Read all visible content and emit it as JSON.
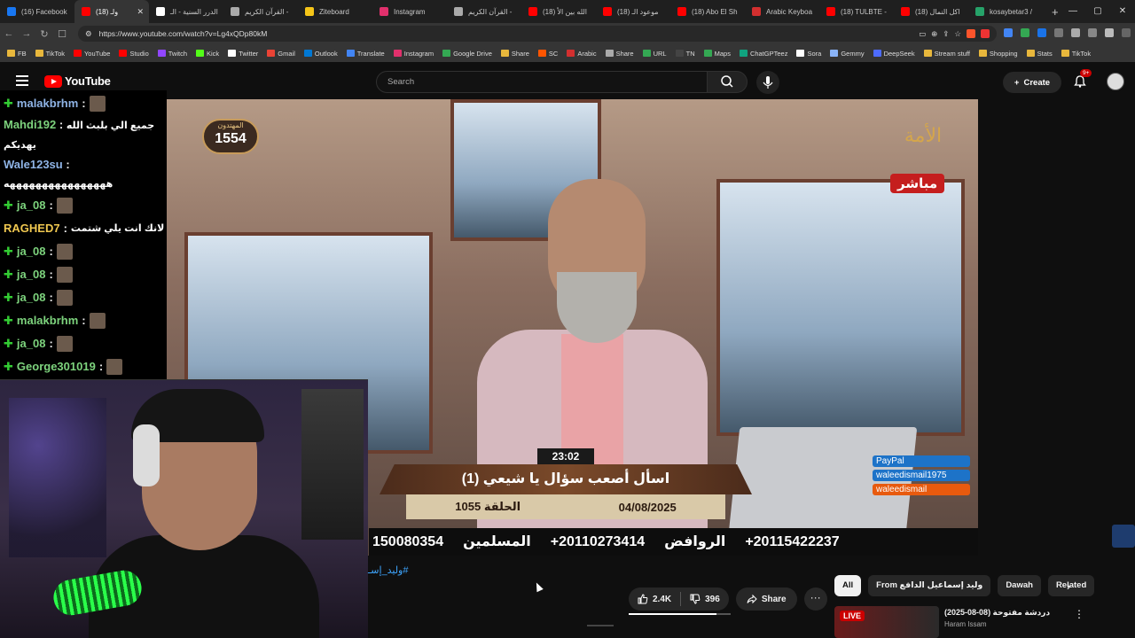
{
  "browser": {
    "tabs": [
      {
        "label": "(16) Facebook",
        "color": "#1877f2",
        "active": false
      },
      {
        "label": "(18) ولـ",
        "color": "#ff0000",
        "active": true
      },
      {
        "label": "الدرر السنية - الـ",
        "color": "#ffffff",
        "active": false
      },
      {
        "label": "القرآن الكريم - ",
        "color": "#aaaaaa",
        "active": false
      },
      {
        "label": "Ziteboard",
        "color": "#f5c518",
        "active": false
      },
      {
        "label": "Instagram",
        "color": "#e1306c",
        "active": false
      },
      {
        "label": "القرآن الكريم - ",
        "color": "#aaaaaa",
        "active": false
      },
      {
        "label": "(18) الله بين الأ",
        "color": "#ff0000",
        "active": false
      },
      {
        "label": "(18) موعود الـ",
        "color": "#ff0000",
        "active": false
      },
      {
        "label": "(18) Abo El Sh",
        "color": "#ff0000",
        "active": false
      },
      {
        "label": "Arabic Keyboa",
        "color": "#d32f2f",
        "active": false
      },
      {
        "label": "(18) TULBTE - ",
        "color": "#ff0000",
        "active": false
      },
      {
        "label": "(18) اكل النمال",
        "color": "#ff0000",
        "active": false
      },
      {
        "label": "kosaybetar3 / ",
        "color": "#26a269",
        "active": false
      }
    ],
    "new_tab": "+",
    "url": "https://www.youtube.com/watch?v=Lg4xQDp80kM",
    "bookmarks": [
      {
        "label": "FB",
        "type": "folder"
      },
      {
        "label": "TikTok",
        "type": "folder"
      },
      {
        "label": "YouTube",
        "type": "site",
        "color": "#ff0000"
      },
      {
        "label": "Studio",
        "type": "site",
        "color": "#ff0000"
      },
      {
        "label": "Twitch",
        "type": "site",
        "color": "#9146ff"
      },
      {
        "label": "Kick",
        "type": "site",
        "color": "#53fc18"
      },
      {
        "label": "Twitter",
        "type": "site",
        "color": "#ffffff"
      },
      {
        "label": "Gmail",
        "type": "site",
        "color": "#ea4335"
      },
      {
        "label": "Outlook",
        "type": "site",
        "color": "#0078d4"
      },
      {
        "label": "Translate",
        "type": "site",
        "color": "#4285f4"
      },
      {
        "label": "Instagram",
        "type": "site",
        "color": "#e1306c"
      },
      {
        "label": "Google Drive",
        "type": "site",
        "color": "#34a853"
      },
      {
        "label": "Share",
        "type": "folder"
      },
      {
        "label": "SC",
        "type": "site",
        "color": "#ff5500"
      },
      {
        "label": "Arabic",
        "type": "site",
        "color": "#d32f2f"
      },
      {
        "label": "Share",
        "type": "site",
        "color": "#aaaaaa"
      },
      {
        "label": "URL",
        "type": "site",
        "color": "#34a853"
      },
      {
        "label": "TN",
        "type": "site",
        "color": "#444444"
      },
      {
        "label": "Maps",
        "type": "site",
        "color": "#34a853"
      },
      {
        "label": "ChatGPTeez",
        "type": "site",
        "color": "#10a37f"
      },
      {
        "label": "Sora",
        "type": "site",
        "color": "#ffffff"
      },
      {
        "label": "Gemmy",
        "type": "site",
        "color": "#8ab4f8"
      },
      {
        "label": "DeepSeek",
        "type": "site",
        "color": "#4d6bfe"
      },
      {
        "label": "Stream stuff",
        "type": "folder"
      },
      {
        "label": "Shopping",
        "type": "folder"
      },
      {
        "label": "Stats",
        "type": "folder"
      },
      {
        "label": "TikTok",
        "type": "folder"
      }
    ]
  },
  "youtube": {
    "logo_text": "YouTube",
    "search_placeholder": "Search",
    "create_label": "Create",
    "notification_count": "9+"
  },
  "chat": [
    {
      "user": "malakbrhm",
      "color": "blue",
      "gem": true,
      "emote": true
    },
    {
      "user": "Mahdi192",
      "color": "green",
      "gem": false,
      "text": "جميع الي بلبث الله",
      "text2": "يهديكم"
    },
    {
      "user": "Wale123su",
      "color": "blue",
      "gem": false,
      "text2": "ههههههههههههههههه"
    },
    {
      "user": "ja_08",
      "color": "green",
      "gem": true,
      "emote": true
    },
    {
      "user": "RAGHED7",
      "color": "gold",
      "gem": false,
      "text": "لانك انت يلي شتمت"
    },
    {
      "user": "ja_08",
      "color": "green",
      "gem": true,
      "emote": true
    },
    {
      "user": "ja_08",
      "color": "green",
      "gem": true,
      "emote": true
    },
    {
      "user": "ja_08",
      "color": "green",
      "gem": true,
      "emote": true
    },
    {
      "user": "malakbrhm",
      "color": "green",
      "gem": true,
      "emote": true
    },
    {
      "user": "ja_08",
      "color": "green",
      "gem": true,
      "emote": true
    },
    {
      "user": "George301019",
      "color": "green",
      "gem": true,
      "emote": true
    }
  ],
  "video": {
    "badge_top": "المهتدون",
    "badge_num": "1554",
    "channel_logo": "الأمة",
    "live_label": "مباشر",
    "time": "23:02",
    "title": "اسأل أصعب سؤال يا شيعي (1)",
    "episode": "الحلقة 1055",
    "date": "04/08/2025",
    "social": [
      "PayPal",
      "waleedismail1975",
      "waleedismail"
    ],
    "ticker": [
      "150080354",
      "المسلمين",
      "+20110273414",
      "الروافض",
      "+20115422237"
    ]
  },
  "below": {
    "hashtag": "#وليد_إسـ",
    "likes": "2.4K",
    "dislikes": "396",
    "like_ratio": 0.86,
    "share_label": "Share",
    "more_label": "···"
  },
  "chips": [
    "All",
    "From وليد إسماعيل الدافع",
    "Dawah",
    "Related"
  ],
  "related": {
    "live_label": "LIVE",
    "title": "دردشة مفتوحة (08-08-2025)",
    "channel": "Haram Issam"
  }
}
